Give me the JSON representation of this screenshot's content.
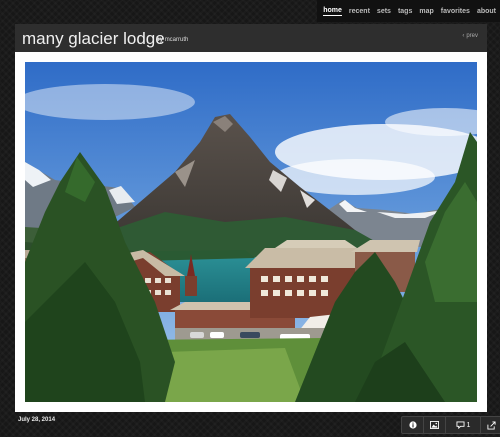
{
  "nav": {
    "items": [
      {
        "label": "home",
        "active": true
      },
      {
        "label": "recent",
        "active": false
      },
      {
        "label": "sets",
        "active": false
      },
      {
        "label": "tags",
        "active": false
      },
      {
        "label": "map",
        "active": false
      },
      {
        "label": "favorites",
        "active": false
      },
      {
        "label": "about",
        "active": false
      }
    ]
  },
  "photo": {
    "title": "many glacier lodge",
    "by_label": "by",
    "author": "mcarruth",
    "prev_label": "prev",
    "date": "July 28, 2014"
  },
  "toolbar": {
    "info_icon": "info-icon",
    "image_icon": "image-icon",
    "comment_icon": "comment-icon",
    "comment_count": "1",
    "share_icon": "share-icon"
  },
  "colors": {
    "background": "#171717",
    "titlebar": "#2e2e2e",
    "frame": "#ffffff",
    "sky": "#3f7fd1",
    "lake": "#1f7f87"
  }
}
